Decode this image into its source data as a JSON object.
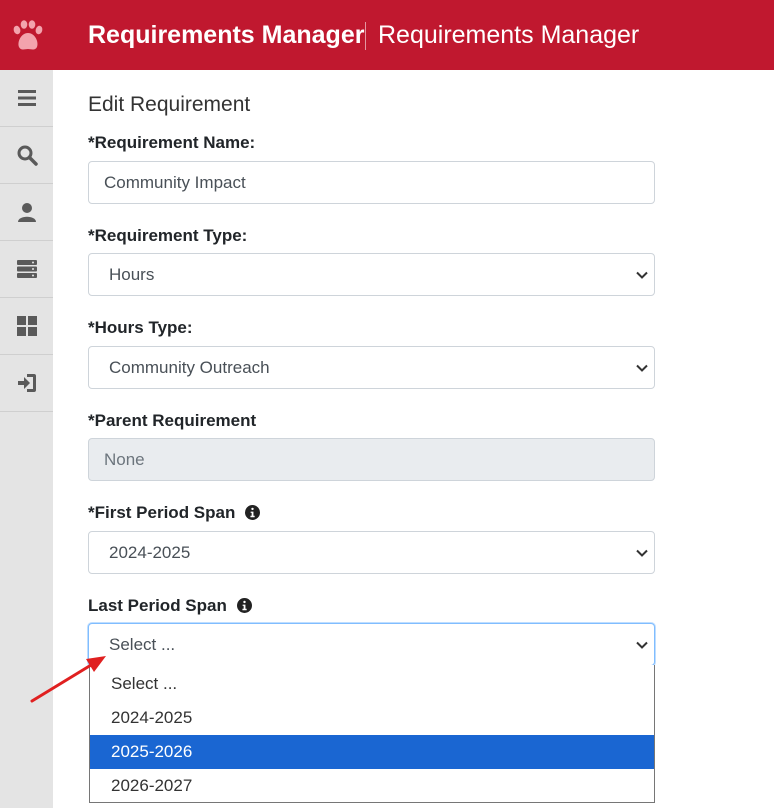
{
  "header": {
    "app_title": "Requirements Manager",
    "app_subtitle": "Requirements Manager",
    "brand_color": "#c0182f",
    "logo_icon": "paw-icon"
  },
  "sidebar": {
    "items": [
      {
        "icon": "menu-icon"
      },
      {
        "icon": "search-icon"
      },
      {
        "icon": "user-icon"
      },
      {
        "icon": "server-icon"
      },
      {
        "icon": "dashboard-icon"
      },
      {
        "icon": "sign-in-icon"
      }
    ]
  },
  "form": {
    "heading": "Edit Requirement",
    "requirement_name": {
      "label": "*Requirement Name:",
      "value": "Community Impact"
    },
    "requirement_type": {
      "label": "*Requirement Type:",
      "value": "Hours"
    },
    "hours_type": {
      "label": "*Hours Type:",
      "value": "Community Outreach"
    },
    "parent_requirement": {
      "label": "*Parent Requirement",
      "value": "None"
    },
    "first_period_span": {
      "label": "*First Period Span",
      "value": "2024-2025"
    },
    "last_period_span": {
      "label": "Last Period Span",
      "value": "Select ...",
      "options": [
        "Select ...",
        "2024-2025",
        "2025-2026",
        "2026-2027"
      ],
      "highlighted_option": "2025-2026"
    }
  },
  "colors": {
    "highlight": "#1a66d2",
    "annotation_arrow": "#e02020"
  }
}
